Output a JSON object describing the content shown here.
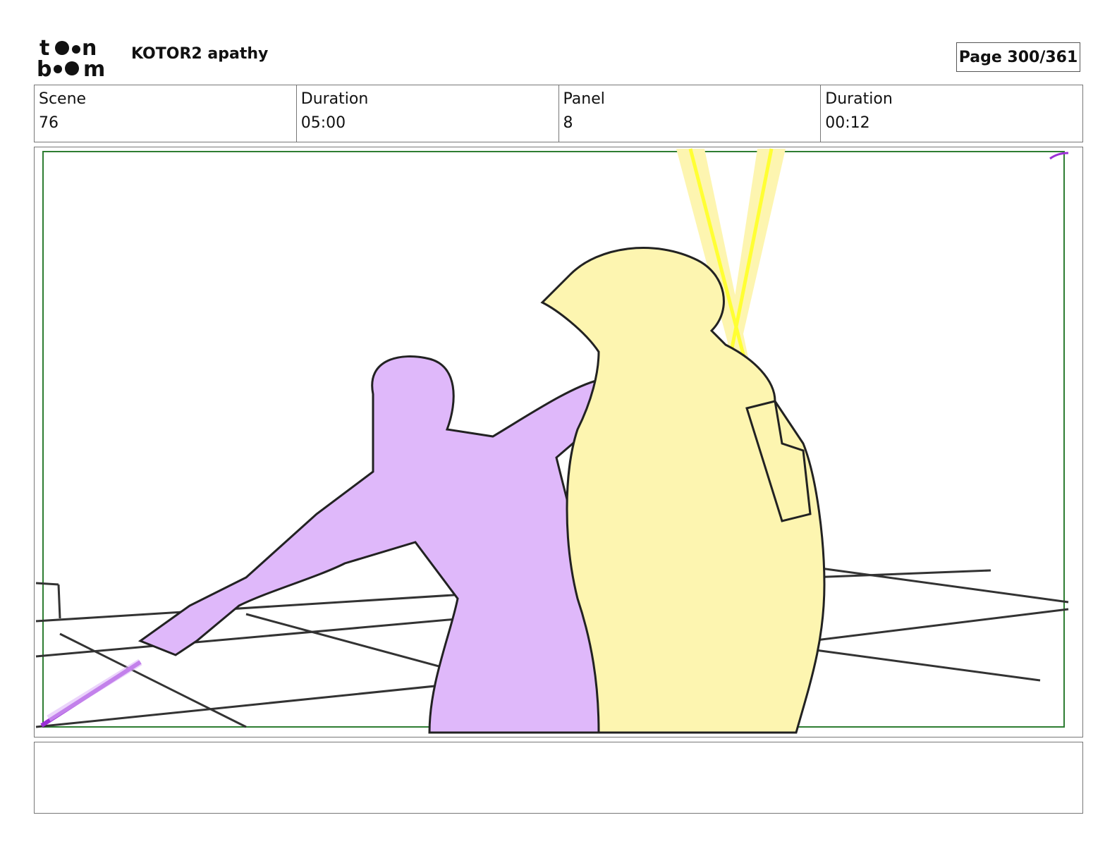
{
  "header": {
    "logo_text": "toon boom",
    "project_title": "KOTOR2 apathy",
    "page_indicator": "Page 300/361"
  },
  "info": {
    "scene_label": "Scene",
    "scene_value": "76",
    "scene_duration_label": "Duration",
    "scene_duration_value": "05:00",
    "panel_label": "Panel",
    "panel_value": "8",
    "panel_duration_label": "Duration",
    "panel_duration_value": "00:12"
  },
  "panel_image": {
    "icon": "storyboard-sketch",
    "colors": {
      "purple_fill": "#dfb8fa",
      "yellow_fill": "#fdf5b0",
      "saber_yellow": "#ffff33",
      "saber_purple": "#9b2fd6",
      "frame_green": "#2e7d32"
    }
  },
  "notes": {
    "text": ""
  }
}
